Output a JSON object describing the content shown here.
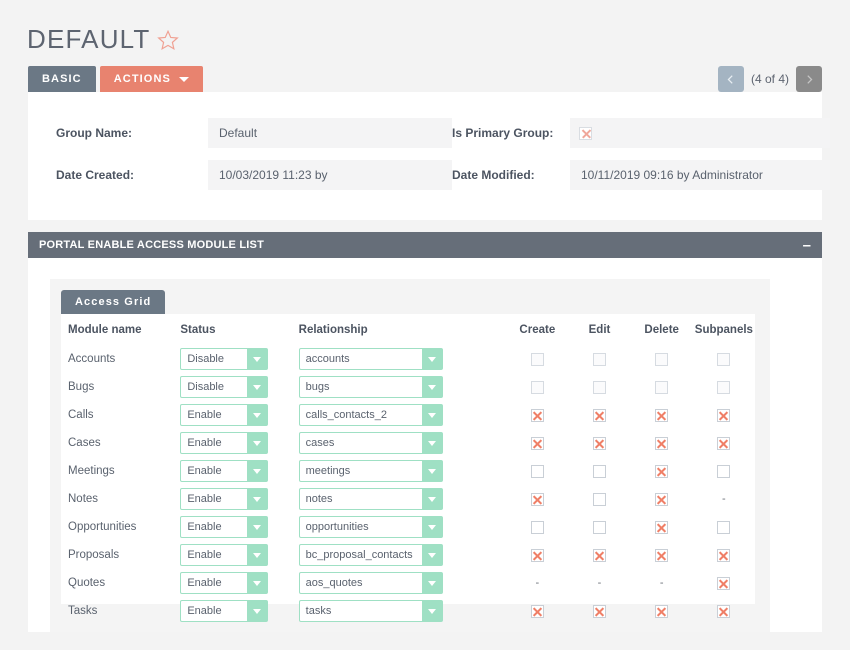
{
  "header": {
    "title": "DEFAULT",
    "star_icon": "star-outline-icon"
  },
  "tabs": [
    {
      "label": "BASIC",
      "key": "basic"
    },
    {
      "label": "ACTIONS",
      "key": "actions",
      "caret_icon": "caret-down-icon"
    }
  ],
  "pagination": {
    "prev_icon": "chevron-left-icon",
    "next_icon": "chevron-right-icon",
    "count_label": "(4 of 4)"
  },
  "fields": {
    "group_name_label": "Group Name:",
    "group_name_value": "Default",
    "date_created_label": "Date Created:",
    "date_created_value": "10/03/2019 11:23 by",
    "is_primary_group_label": "Is Primary Group:",
    "is_primary_group_checked": true,
    "date_modified_label": "Date Modified:",
    "date_modified_value": "10/11/2019 09:16 by Administrator"
  },
  "panel": {
    "title": "PORTAL ENABLE ACCESS MODULE LIST",
    "collapse_icon": "minus-icon",
    "collapse_glyph": "–",
    "grid_tab_label": "Access Grid"
  },
  "grid": {
    "columns": {
      "module": "Module name",
      "status": "Status",
      "relationship": "Relationship",
      "create": "Create",
      "edit": "Edit",
      "delete": "Delete",
      "subpanels": "Subpanels"
    },
    "rows": [
      {
        "module": "Accounts",
        "status": "Disable",
        "relationship": "accounts",
        "create": "unchecked-muted",
        "edit": "unchecked-muted",
        "delete": "unchecked-muted",
        "subpanels": "unchecked-muted"
      },
      {
        "module": "Bugs",
        "status": "Disable",
        "relationship": "bugs",
        "create": "unchecked-muted",
        "edit": "unchecked-muted",
        "delete": "unchecked-muted",
        "subpanels": "unchecked-muted"
      },
      {
        "module": "Calls",
        "status": "Enable",
        "relationship": "calls_contacts_2",
        "create": "checked",
        "edit": "checked",
        "delete": "checked",
        "subpanels": "checked"
      },
      {
        "module": "Cases",
        "status": "Enable",
        "relationship": "cases",
        "create": "checked",
        "edit": "checked",
        "delete": "checked",
        "subpanels": "checked"
      },
      {
        "module": "Meetings",
        "status": "Enable",
        "relationship": "meetings",
        "create": "unchecked",
        "edit": "unchecked",
        "delete": "checked",
        "subpanels": "unchecked"
      },
      {
        "module": "Notes",
        "status": "Enable",
        "relationship": "notes",
        "create": "checked",
        "edit": "unchecked",
        "delete": "checked",
        "subpanels": "dash"
      },
      {
        "module": "Opportunities",
        "status": "Enable",
        "relationship": "opportunities",
        "create": "unchecked",
        "edit": "unchecked",
        "delete": "checked",
        "subpanels": "unchecked"
      },
      {
        "module": "Proposals",
        "status": "Enable",
        "relationship": "bc_proposal_contacts",
        "create": "checked",
        "edit": "checked",
        "delete": "checked",
        "subpanels": "checked"
      },
      {
        "module": "Quotes",
        "status": "Enable",
        "relationship": "aos_quotes",
        "create": "dash",
        "edit": "dash",
        "delete": "dash",
        "subpanels": "checked"
      },
      {
        "module": "Tasks",
        "status": "Enable",
        "relationship": "tasks",
        "create": "checked",
        "edit": "checked",
        "delete": "checked",
        "subpanels": "checked"
      }
    ],
    "dash_glyph": "-"
  },
  "colors": {
    "accent_salmon": "#e8836f",
    "slate": "#6b7885",
    "panel_header": "#666e79",
    "select_green": "#9fe0c4",
    "check_x": "#ef7f67",
    "page_bg": "#f3f3f3"
  }
}
